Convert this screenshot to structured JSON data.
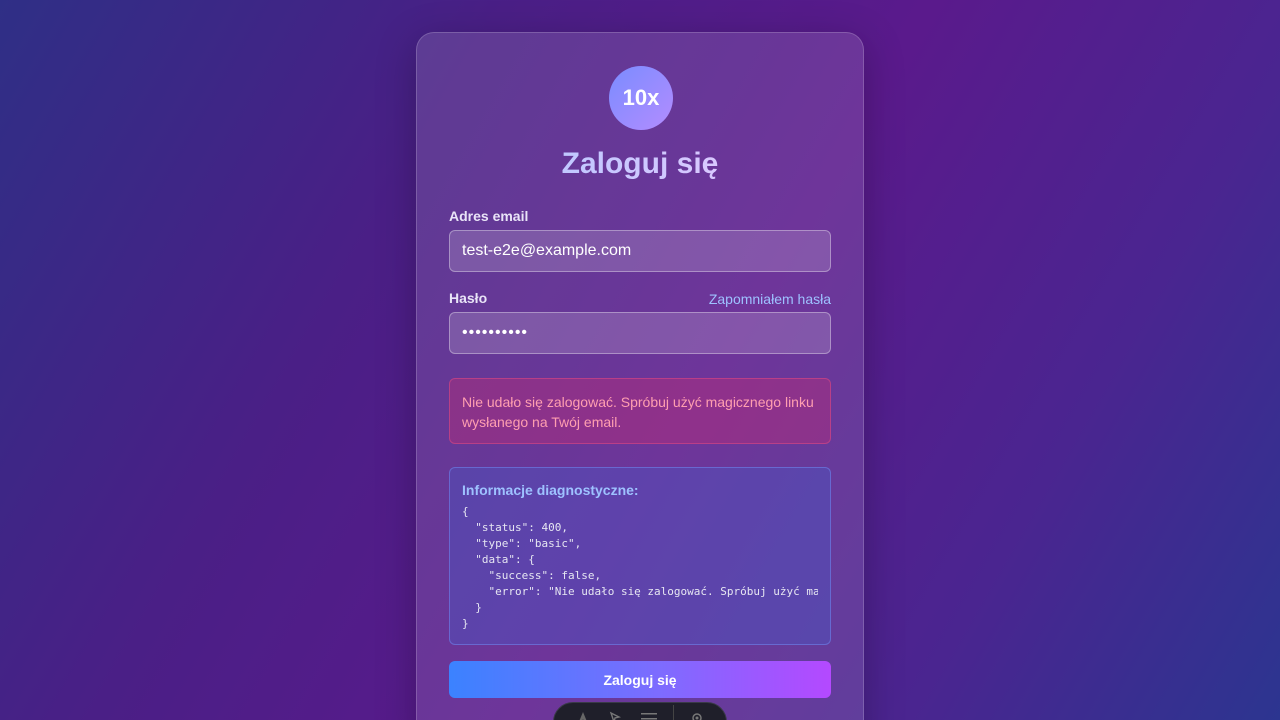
{
  "logo": {
    "text": "10x"
  },
  "title": "Zaloguj się",
  "email": {
    "label": "Adres email",
    "value": "test-e2e@example.com"
  },
  "password": {
    "label": "Hasło",
    "value": "••••••••••",
    "forgot_link": "Zapomniałem hasła"
  },
  "error_message": "Nie udało się zalogować. Spróbuj użyć magicznego linku wysłanego na Twój email.",
  "diagnostics": {
    "title": "Informacje diagnostyczne:",
    "code": "{\n  \"status\": 400,\n  \"type\": \"basic\",\n  \"data\": {\n    \"success\": false,\n    \"error\": \"Nie udało się zalogować. Spróbuj użyć ma\n  }\n}"
  },
  "submit_label": "Zaloguj się",
  "toolbar": {
    "icons": [
      "astro-icon",
      "inspect-icon",
      "menu-icon",
      "settings-icon"
    ]
  },
  "colors": {
    "accent_blue": "#3b82ff",
    "accent_purple": "#b449ff",
    "error_text": "#ff9fb0"
  }
}
